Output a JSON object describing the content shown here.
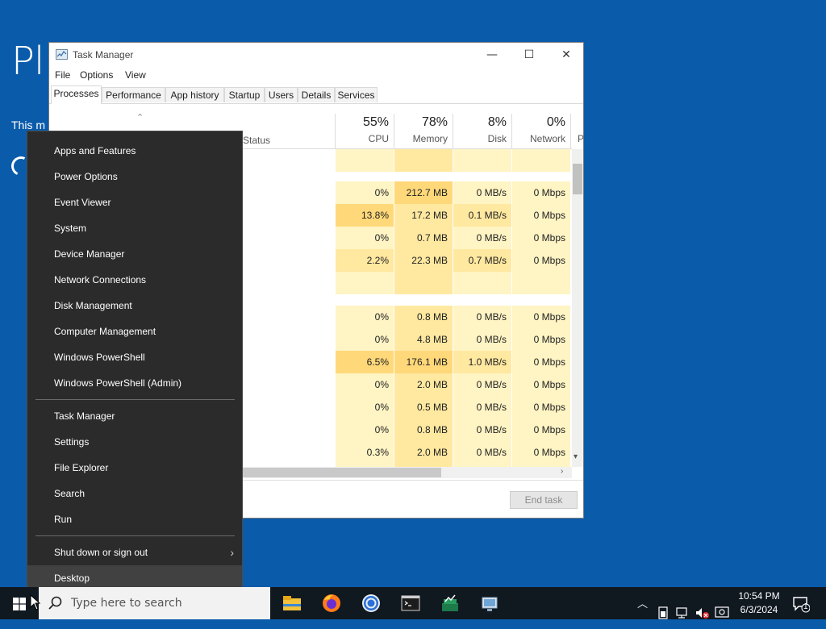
{
  "background": {
    "title": "Pl",
    "subtitle": "This m"
  },
  "task_manager": {
    "title": "Task Manager",
    "window_buttons": {
      "minimize": "—",
      "maximize": "☐",
      "close": "✕"
    },
    "menu": [
      "File",
      "Options",
      "View"
    ],
    "tabs": [
      "Processes",
      "Performance",
      "App history",
      "Startup",
      "Users",
      "Details",
      "Services"
    ],
    "active_tab": "Processes",
    "columns": {
      "status": "Status",
      "cpu": {
        "pct": "55%",
        "label": "CPU"
      },
      "memory": {
        "pct": "78%",
        "label": "Memory"
      },
      "disk": {
        "pct": "8%",
        "label": "Disk"
      },
      "network": {
        "pct": "0%",
        "label": "Network"
      },
      "power": "P"
    },
    "rows": [
      {
        "cpu": "",
        "memory": "",
        "disk": "",
        "network": ""
      },
      {
        "cpu": "0%",
        "memory": "212.7 MB",
        "disk": "0 MB/s",
        "network": "0 Mbps"
      },
      {
        "cpu": "13.8%",
        "memory": "17.2 MB",
        "disk": "0.1 MB/s",
        "network": "0 Mbps"
      },
      {
        "cpu": "0%",
        "memory": "0.7 MB",
        "disk": "0 MB/s",
        "network": "0 Mbps"
      },
      {
        "cpu": "2.2%",
        "memory": "22.3 MB",
        "disk": "0.7 MB/s",
        "network": "0 Mbps"
      },
      {
        "cpu": "",
        "memory": "",
        "disk": "",
        "network": ""
      },
      {
        "cpu": "0%",
        "memory": "0.8 MB",
        "disk": "0 MB/s",
        "network": "0 Mbps"
      },
      {
        "cpu": "0%",
        "memory": "4.8 MB",
        "disk": "0 MB/s",
        "network": "0 Mbps"
      },
      {
        "cpu": "6.5%",
        "memory": "176.1 MB",
        "disk": "1.0 MB/s",
        "network": "0 Mbps"
      },
      {
        "cpu": "0%",
        "memory": "2.0 MB",
        "disk": "0 MB/s",
        "network": "0 Mbps"
      },
      {
        "cpu": "0%",
        "memory": "0.5 MB",
        "disk": "0 MB/s",
        "network": "0 Mbps"
      },
      {
        "cpu": "0%",
        "memory": "0.8 MB",
        "disk": "0 MB/s",
        "network": "0 Mbps"
      },
      {
        "cpu": "0.3%",
        "memory": "2.0 MB",
        "disk": "0 MB/s",
        "network": "0 Mbps"
      }
    ],
    "end_task": "End task"
  },
  "context_menu": {
    "group1": [
      "Apps and Features",
      "Power Options",
      "Event Viewer",
      "System",
      "Device Manager",
      "Network Connections",
      "Disk Management",
      "Computer Management",
      "Windows PowerShell",
      "Windows PowerShell (Admin)"
    ],
    "group2": [
      "Task Manager",
      "Settings",
      "File Explorer",
      "Search",
      "Run"
    ],
    "group3": [
      "Shut down or sign out",
      "Desktop"
    ]
  },
  "taskbar": {
    "search_placeholder": "Type here to search",
    "time": "10:54 PM",
    "date": "6/3/2024",
    "notification_count": "1"
  },
  "colors": {
    "desktop": "#0b5bab",
    "heat_light": "#fff4c4",
    "heat_medium": "#ffe8a0",
    "heat_strong": "#ffd879",
    "menu_bg": "#2b2b2b"
  }
}
